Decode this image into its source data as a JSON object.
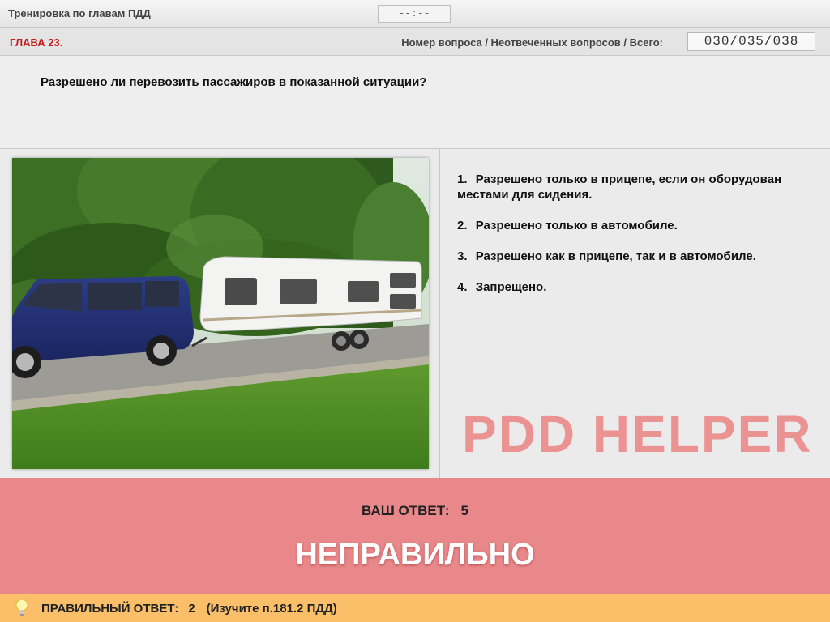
{
  "header": {
    "app_title": "Тренировка по главам ПДД",
    "timer": "--:--"
  },
  "chapter_bar": {
    "chapter": "ГЛАВА 23.",
    "counter_label": "Номер вопроса / Неотвеченных вопросов / Всего:",
    "counter_value": "030/035/038"
  },
  "question": {
    "text": "Разрешено ли перевозить пассажиров в показанной ситуации?"
  },
  "answers": [
    {
      "num": "1.",
      "text": "Разрешено только в прицепе, если он оборудован местами для сидения."
    },
    {
      "num": "2.",
      "text": "Разрешено только в автомобиле."
    },
    {
      "num": "3.",
      "text": "Разрешено как в прицепе, так и в автомобиле."
    },
    {
      "num": "4.",
      "text": "Запрещено."
    }
  ],
  "watermark": "PDD HELPER",
  "result": {
    "your_answer_label": "ВАШ  ОТВЕТ:",
    "your_answer_value": "5",
    "verdict": "НЕПРАВИЛЬНО"
  },
  "footer": {
    "icon": "lightbulb-icon",
    "correct_label": "ПРАВИЛЬНЫЙ ОТВЕТ:",
    "correct_value": "2",
    "reference": "(Изучите п.181.2 ПДД)"
  },
  "colors": {
    "chapter_red": "#c41c1c",
    "result_bg": "#e9888a",
    "footer_bg": "#fcbf69",
    "watermark": "#ec8a8a"
  }
}
